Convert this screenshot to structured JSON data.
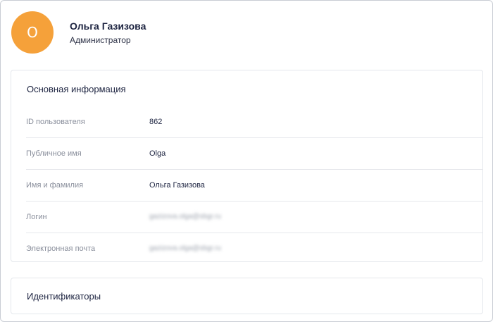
{
  "profile": {
    "avatar_letter": "О",
    "name": "Ольга Газизова",
    "role": "Администратор",
    "avatar_color": "#f5a13a"
  },
  "main_info": {
    "title": "Основная информация",
    "rows": [
      {
        "label": "ID пользователя",
        "value": "862"
      },
      {
        "label": "Публичное имя",
        "value": "Olga"
      },
      {
        "label": "Имя и фамилия",
        "value": "Ольга Газизова"
      },
      {
        "label": "Логин",
        "value": "gazizova.olga@sbgr.ru"
      },
      {
        "label": "Электронная почта",
        "value": "gazizova.olga@sbgr.ru"
      }
    ]
  },
  "identifiers": {
    "title": "Идентификаторы"
  }
}
